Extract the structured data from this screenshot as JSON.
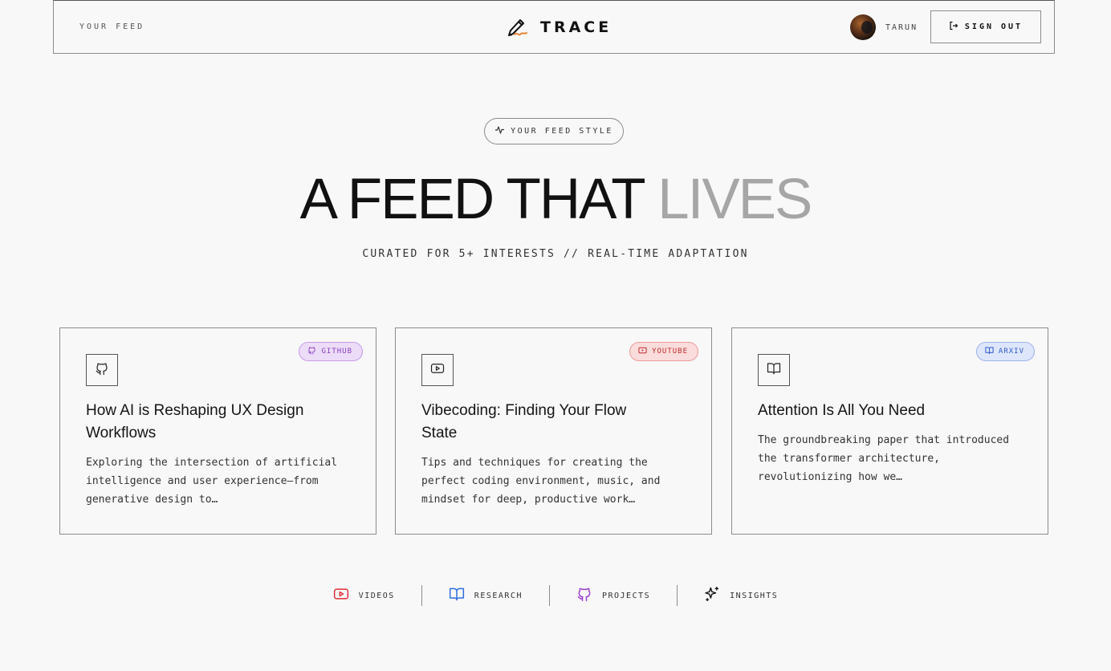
{
  "header": {
    "feed_label": "YOUR FEED",
    "brand": "TRACE",
    "user_name": "TARUN",
    "signout_label": "SIGN OUT"
  },
  "hero": {
    "pill_label": "YOUR FEED STYLE",
    "headline_dark": "A FEED THAT",
    "headline_light": "LIVES",
    "subhead": "CURATED FOR 5+ INTERESTS // REAL-TIME ADAPTATION"
  },
  "cards": [
    {
      "badge": "GITHUB",
      "icon": "github-icon",
      "title": "How AI is Reshaping UX Design Workflows",
      "description": "Exploring the intersection of artificial intelligence and user experience—from generative design to…"
    },
    {
      "badge": "YOUTUBE",
      "icon": "youtube-icon",
      "title": "Vibecoding: Finding Your Flow State",
      "description": "Tips and techniques for creating the perfect coding environment, music, and mindset for deep, productive work…"
    },
    {
      "badge": "ARXIV",
      "icon": "book-icon",
      "title": "Attention Is All You Need",
      "description": "The groundbreaking paper that introduced the transformer architecture, revolutionizing how we…"
    }
  ],
  "categories": [
    {
      "label": "VIDEOS",
      "icon": "youtube-icon",
      "color": "#e0313b"
    },
    {
      "label": "RESEARCH",
      "icon": "book-icon",
      "color": "#2f6fe0"
    },
    {
      "label": "PROJECTS",
      "icon": "github-icon",
      "color": "#9b3fd1"
    },
    {
      "label": "INSIGHTS",
      "icon": "sparkles-icon",
      "color": "#111111"
    }
  ],
  "colors": {
    "background": "#f8f8f8",
    "border": "#8c8c8c",
    "headline_light": "#a6a6a6"
  }
}
